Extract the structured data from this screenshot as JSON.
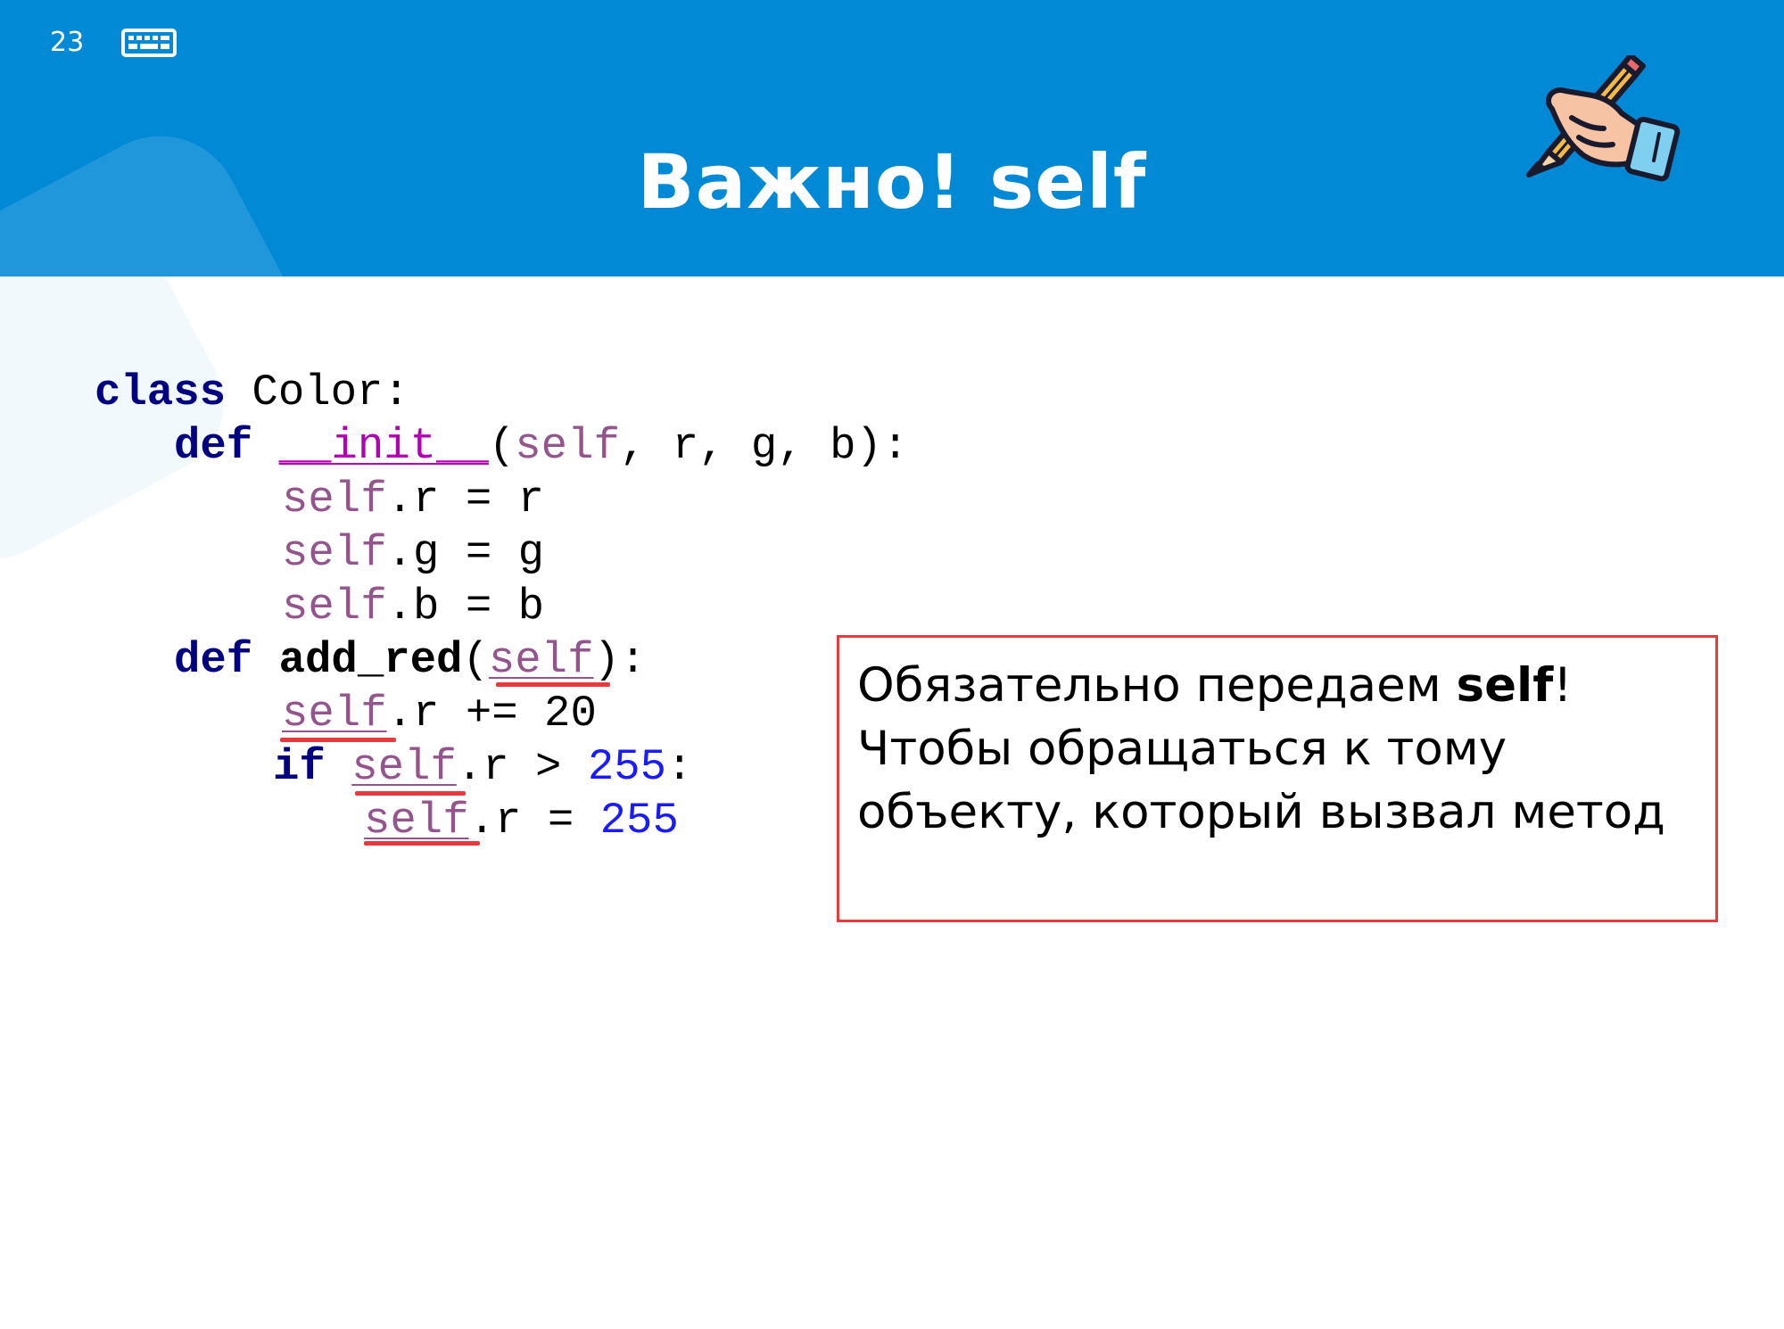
{
  "slide": {
    "number": "23",
    "title": "Важно! self"
  },
  "code": {
    "line1": {
      "kw": "class",
      "rest": " Color:"
    },
    "line2": {
      "kw": "def",
      "fn": "__init__",
      "open": "(",
      "self": "self",
      "rest": ", r, g, b):"
    },
    "line3": {
      "self": "self",
      "rest": ".r = r"
    },
    "line4": {
      "self": "self",
      "rest": ".g = g"
    },
    "line5": {
      "self": "self",
      "rest": ".b = b"
    },
    "line6": {
      "kw": "def",
      "fn": "add_red",
      "open": "(",
      "self": "self",
      "rest": "):"
    },
    "line7": {
      "self": "self",
      "rest": ".r += 20"
    },
    "line8": {
      "kw": "if",
      "self": "self",
      "rest": ".r > ",
      "num": "255",
      "end": ":"
    },
    "line9": {
      "self": "self",
      "rest": ".r = ",
      "num": "255"
    }
  },
  "note": {
    "text1": "Обязательно передаем ",
    "bold": "self",
    "text2": "! Чтобы обращаться к тому объекту, который вызвал метод"
  },
  "icons": [
    "keyboard-icon",
    "hand-writing-icon"
  ],
  "colors": {
    "header_bg": "#0289d6",
    "keyword": "#000080",
    "self": "#94558d",
    "number": "#1a1aff",
    "highlight_red": "#e8393c"
  }
}
